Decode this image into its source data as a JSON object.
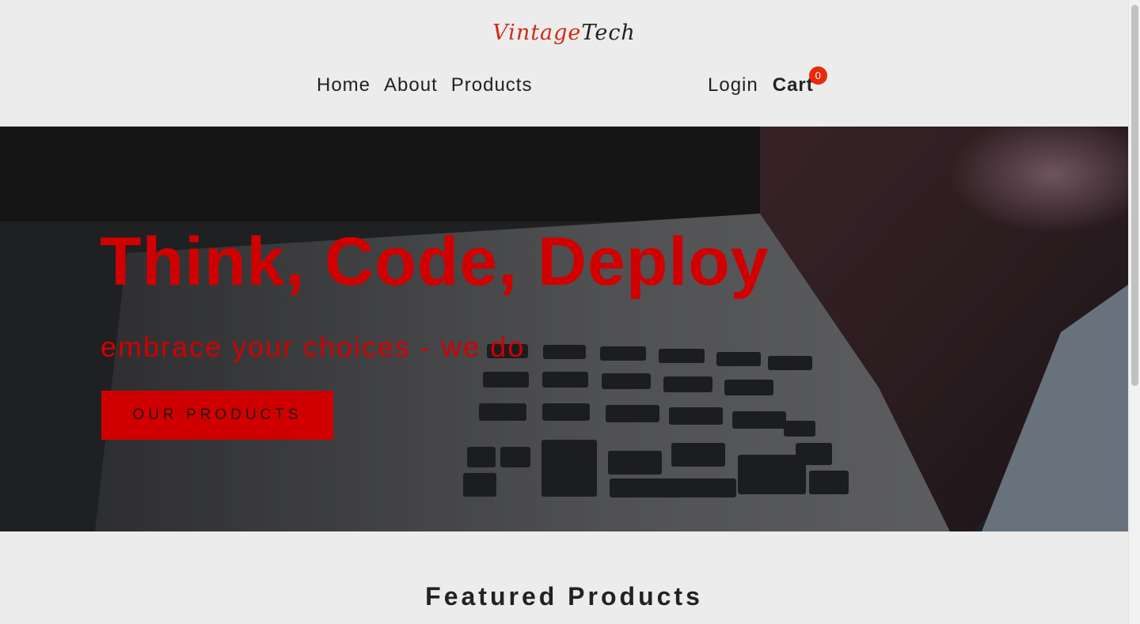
{
  "header": {
    "logo": {
      "part1": "Vintage",
      "part2": "Tech"
    },
    "nav": {
      "home": "Home",
      "about": "About",
      "products": "Products"
    },
    "auth": {
      "login": "Login",
      "cart": "Cart",
      "cart_count": "0"
    }
  },
  "hero": {
    "title": "Think, Code, Deploy",
    "subtitle": "embrace your choices - we do",
    "button": "OUR PRODUCTS",
    "image": "laptop-keyboard-photo"
  },
  "featured": {
    "title": "Featured Products"
  },
  "colors": {
    "accent": "#d10000",
    "logo_red": "#cf2b1a",
    "badge": "#e8290c",
    "background": "#ececec",
    "text": "#222222"
  }
}
